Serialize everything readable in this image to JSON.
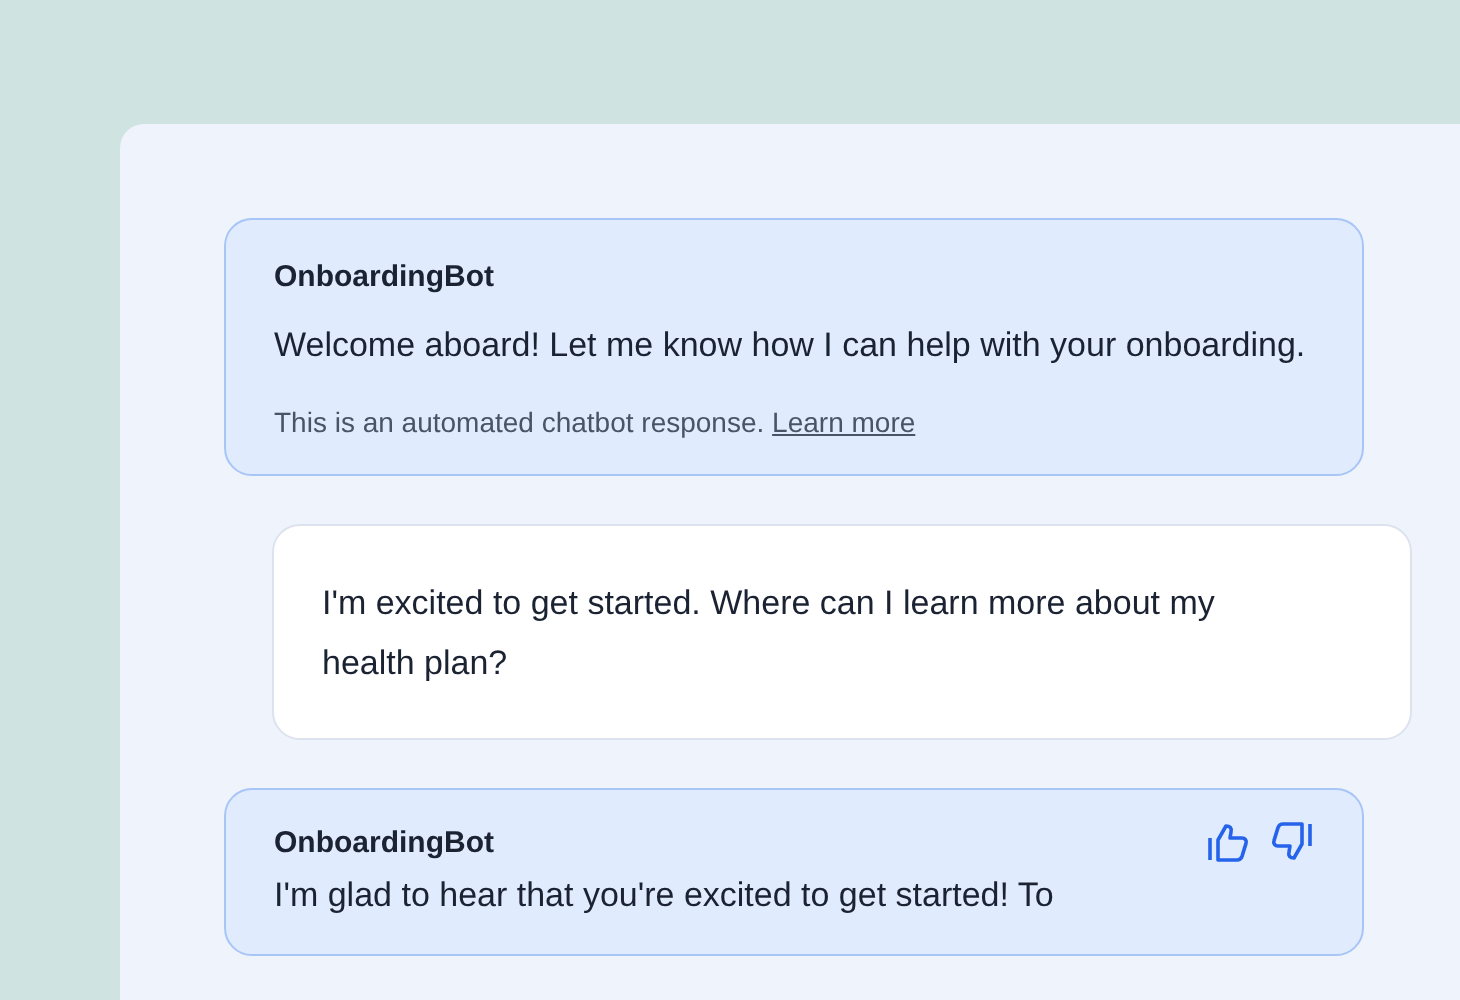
{
  "messages": [
    {
      "kind": "bot",
      "sender": "OnboardingBot",
      "text": "Welcome aboard! Let me know how I can help with your onboarding.",
      "disclaimer": "This is an automated chatbot response.",
      "link": "Learn more"
    },
    {
      "kind": "user",
      "text": "I'm excited to get started. Where can I learn more about my health plan?"
    },
    {
      "kind": "bot",
      "sender": "OnboardingBot",
      "feedback": true,
      "text": "I'm glad to hear that you're excited to get started! To"
    }
  ]
}
